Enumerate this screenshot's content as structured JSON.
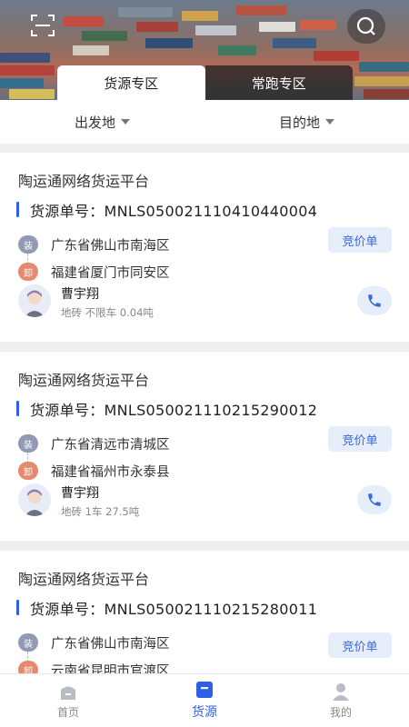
{
  "tabs": [
    {
      "label": "货源专区",
      "active": true
    },
    {
      "label": "常跑专区",
      "active": false
    }
  ],
  "filters": {
    "origin": "出发地",
    "destination": "目的地"
  },
  "labels": {
    "load_badge": "装",
    "unload_badge": "卸",
    "bid_button": "竞价单"
  },
  "cards": [
    {
      "platform": "陶运通网络货运平台",
      "order_no": "货源单号：MNLS050021110410440004",
      "load_addr": "广东省佛山市南海区",
      "unload_addr": "福建省厦门市同安区",
      "person": "曹宇翔",
      "goods": "地砖 不限车 0.04吨"
    },
    {
      "platform": "陶运通网络货运平台",
      "order_no": "货源单号：MNLS050021110215290012",
      "load_addr": "广东省清远市清城区",
      "unload_addr": "福建省福州市永泰县",
      "person": "曹宇翔",
      "goods": "地砖 1车 27.5吨"
    },
    {
      "platform": "陶运通网络货运平台",
      "order_no": "货源单号：MNLS050021110215280011",
      "load_addr": "广东省佛山市南海区",
      "unload_addr": "云南省昆明市官渡区",
      "person": "",
      "goods": ""
    }
  ],
  "bottom_nav": [
    {
      "label": "首页",
      "icon": "home-icon",
      "active": false
    },
    {
      "label": "货源",
      "icon": "cargo-icon",
      "active": true
    },
    {
      "label": "我的",
      "icon": "profile-icon",
      "active": false
    }
  ],
  "colors": {
    "accent": "#2f5fe8",
    "bid_bg": "#e6eefc",
    "load_badge": "#9299b5",
    "unload_badge": "#e48a6e"
  }
}
